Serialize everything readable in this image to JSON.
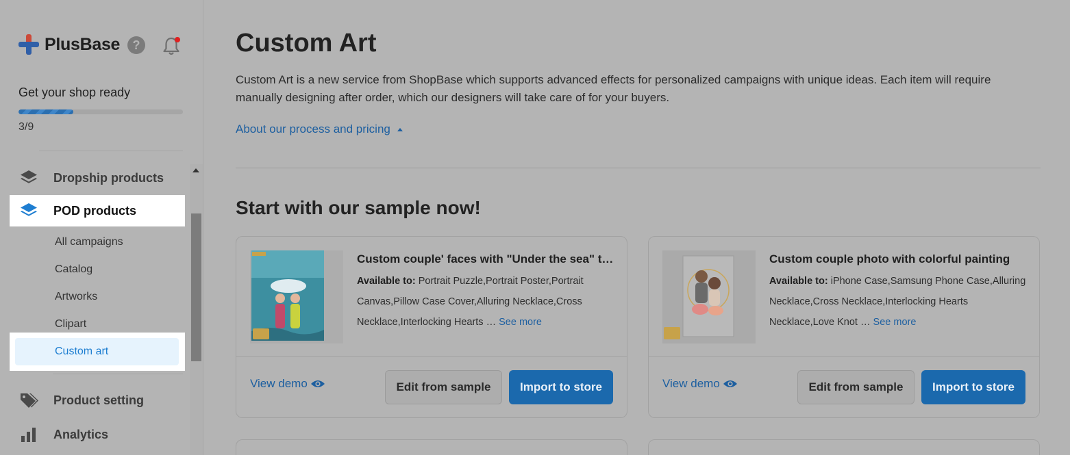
{
  "brand": {
    "name": "PlusBase",
    "logo_colors": [
      "#cc4a39",
      "#2f5fa8"
    ]
  },
  "header_icons": {
    "help": "question-circle-icon",
    "notifications": "bell-icon",
    "notification_dot_color": "#e02020"
  },
  "onboarding": {
    "title": "Get your shop ready",
    "progress_text": "3/9",
    "progress_fraction": 0.333
  },
  "sidebar": {
    "items": [
      {
        "label": "Dropship products",
        "icon": "layers-icon"
      },
      {
        "label": "POD products",
        "icon": "layers-icon",
        "active": true
      },
      {
        "label": "Product setting",
        "icon": "tags-icon"
      },
      {
        "label": "Analytics",
        "icon": "bar-chart-icon"
      }
    ],
    "sub_items": [
      {
        "label": "All campaigns"
      },
      {
        "label": "Catalog"
      },
      {
        "label": "Artworks"
      },
      {
        "label": "Clipart"
      },
      {
        "label": "Custom art",
        "active": true
      }
    ]
  },
  "main": {
    "title": "Custom Art",
    "description": "Custom Art is a new service from ShopBase which supports advanced effects for personalized campaigns with unique ideas. Each item will require manually designing after order, which our designers will take care of for your buyers.",
    "about_link": "About our process and pricing",
    "section_title": "Start with our sample now!",
    "cards": [
      {
        "title": "Custom couple' faces with \"Under the sea\" theme",
        "available_label": "Available to:",
        "available_text": "Portrait Puzzle,Portrait Poster,Portrait Canvas,Pillow Case Cover,Alluring Necklace,Cross Necklace,Interlocking Hearts …",
        "see_more": "See more",
        "view_demo": "View demo",
        "edit_button": "Edit from sample",
        "import_button": "Import to store"
      },
      {
        "title": "Custom couple photo with colorful painting",
        "available_label": "Available to:",
        "available_text": "iPhone Case,Samsung Phone Case,Alluring Necklace,Cross Necklace,Interlocking Hearts Necklace,Love Knot …",
        "see_more": "See more",
        "view_demo": "View demo",
        "edit_button": "Edit from sample",
        "import_button": "Import to store"
      }
    ]
  },
  "colors": {
    "accent": "#1b69ad",
    "link": "#1d5fa0",
    "active_sub_bg": "#e6f3fd",
    "active_sub_text": "#1e7ed1"
  }
}
